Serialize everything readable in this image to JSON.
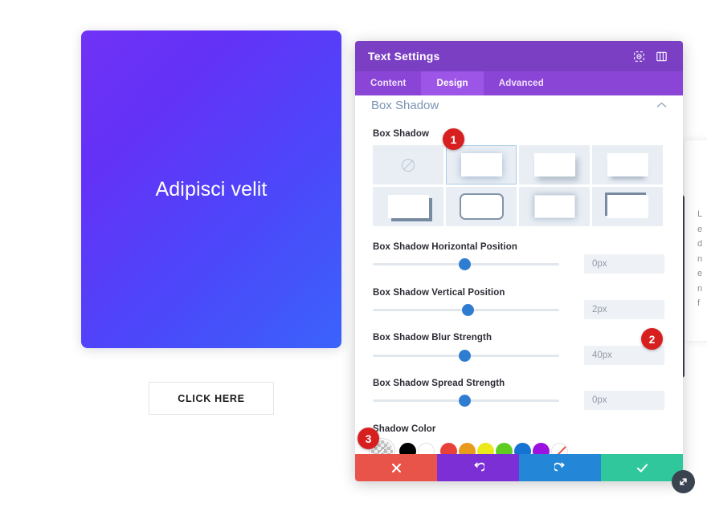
{
  "canvas": {
    "hero": {
      "title": "Adipisci velit"
    },
    "cta": {
      "label": "CLICK HERE"
    }
  },
  "background_panel": {
    "text_fragment": "L\ne\nd\nn\ne\nn\nf"
  },
  "modal": {
    "title": "Text Settings",
    "header_icons": [
      {
        "name": "focus-target-icon"
      },
      {
        "name": "layout-panel-icon"
      }
    ],
    "tabs": [
      {
        "label": "Content",
        "active": false
      },
      {
        "label": "Design",
        "active": true
      },
      {
        "label": "Advanced",
        "active": false
      }
    ],
    "section": {
      "heading": "Box Shadow",
      "collapse_icon": "chevron-up-icon"
    },
    "box_shadow": {
      "label": "Box Shadow",
      "selected_index": 1,
      "presets": [
        {
          "name": "none",
          "style": "none"
        },
        {
          "name": "preset-soft",
          "style": "soft"
        },
        {
          "name": "preset-bottom",
          "style": "bottom"
        },
        {
          "name": "preset-under",
          "style": "under"
        },
        {
          "name": "preset-corner",
          "style": "corner"
        },
        {
          "name": "preset-ring",
          "style": "ring"
        },
        {
          "name": "preset-inner",
          "style": "inner"
        },
        {
          "name": "preset-edge",
          "style": "edge"
        }
      ]
    },
    "sliders": [
      {
        "label": "Box Shadow Horizontal Position",
        "value": "0px",
        "knob_pct": 50
      },
      {
        "label": "Box Shadow Vertical Position",
        "value": "2px",
        "knob_pct": 51
      },
      {
        "label": "Box Shadow Blur Strength",
        "value": "40px",
        "knob_pct": 50
      },
      {
        "label": "Box Shadow Spread Strength",
        "value": "0px",
        "knob_pct": 50
      }
    ],
    "shadow_color": {
      "label": "Shadow Color",
      "swatches": [
        {
          "name": "eyedropper-swatch",
          "hex": "checker"
        },
        {
          "name": "black-swatch",
          "hex": "#000000"
        },
        {
          "name": "white-swatch",
          "hex": "#ffffff"
        },
        {
          "name": "red-swatch",
          "hex": "#e8413a"
        },
        {
          "name": "orange-swatch",
          "hex": "#e89a1c"
        },
        {
          "name": "yellow-swatch",
          "hex": "#ece81b"
        },
        {
          "name": "green-swatch",
          "hex": "#5fcc22"
        },
        {
          "name": "blue-swatch",
          "hex": "#1673d1"
        },
        {
          "name": "purple-swatch",
          "hex": "#9a11e0"
        },
        {
          "name": "none-swatch",
          "hex": "none"
        }
      ]
    },
    "actions": [
      {
        "name": "cancel-button",
        "icon": "✖",
        "color": "#e8534a"
      },
      {
        "name": "undo-button",
        "icon": "↺",
        "color": "#7b2fd4"
      },
      {
        "name": "redo-button",
        "icon": "↻",
        "color": "#2386d6"
      },
      {
        "name": "save-button",
        "icon": "✔",
        "color": "#2fc79b"
      }
    ]
  },
  "badges": [
    {
      "label": "1"
    },
    {
      "label": "2"
    },
    {
      "label": "3"
    }
  ],
  "resize_handle": {
    "name": "resize-handle-icon"
  }
}
